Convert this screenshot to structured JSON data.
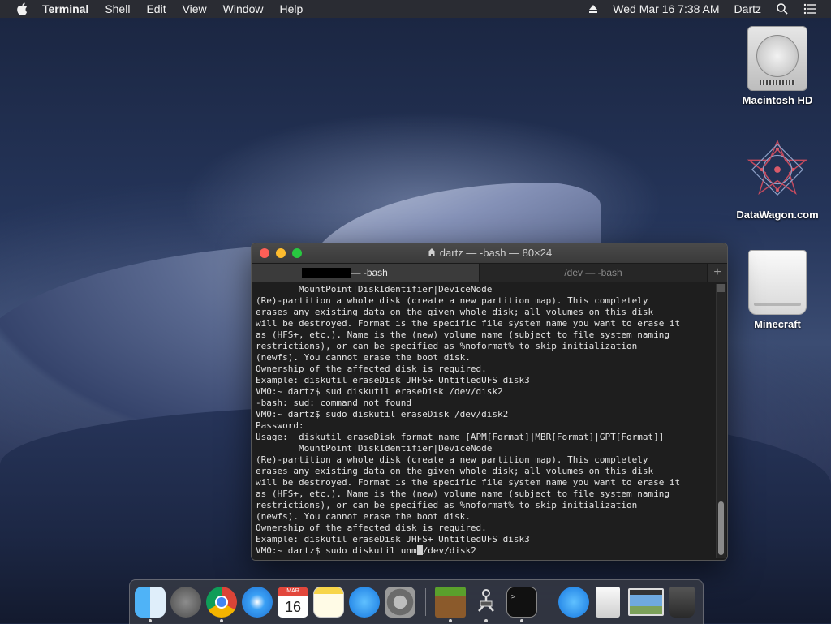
{
  "menubar": {
    "app_name": "Terminal",
    "menus": [
      "Shell",
      "Edit",
      "View",
      "Window",
      "Help"
    ],
    "datetime": "Wed Mar 16  7:38 AM",
    "user": "Dartz"
  },
  "desktop": {
    "icons": [
      "Macintosh HD",
      "DataWagon.com",
      "Minecraft"
    ]
  },
  "terminal": {
    "title": "dartz — -bash — 80×24",
    "tabs": [
      {
        "label": "~ — -bash"
      },
      {
        "label": "/dev — -bash"
      }
    ],
    "add_tab": "+",
    "lines": [
      "        MountPoint|DiskIdentifier|DeviceNode",
      "(Re)-partition a whole disk (create a new partition map). This completely",
      "erases any existing data on the given whole disk; all volumes on this disk",
      "will be destroyed. Format is the specific file system name you want to erase it",
      "as (HFS+, etc.). Name is the (new) volume name (subject to file system naming",
      "restrictions), or can be specified as %noformat% to skip initialization",
      "(newfs). You cannot erase the boot disk.",
      "Ownership of the affected disk is required.",
      "Example: diskutil eraseDisk JHFS+ UntitledUFS disk3",
      "VM0:~ dartz$ sud diskutil eraseDisk /dev/disk2",
      "-bash: sud: command not found",
      "VM0:~ dartz$ sudo diskutil eraseDisk /dev/disk2",
      "Password:",
      "Usage:  diskutil eraseDisk format name [APM[Format]|MBR[Format]|GPT[Format]]",
      "        MountPoint|DiskIdentifier|DeviceNode",
      "(Re)-partition a whole disk (create a new partition map). This completely",
      "erases any existing data on the given whole disk; all volumes on this disk",
      "will be destroyed. Format is the specific file system name you want to erase it",
      "as (HFS+, etc.). Name is the (new) volume name (subject to file system naming",
      "restrictions), or can be specified as %noformat% to skip initialization",
      "(newfs). You cannot erase the boot disk.",
      "Ownership of the affected disk is required.",
      "Example: diskutil eraseDisk JHFS+ UntitledUFS disk3"
    ],
    "prompt_before_cursor": "VM0:~ dartz$ sudo diskutil unm",
    "prompt_after_cursor": "/dev/disk2"
  },
  "dock": {
    "calendar_month": "MAR",
    "calendar_day": "16",
    "apps": [
      "finder-icon",
      "launchpad-icon",
      "chrome-icon",
      "safari-icon",
      "calendar-icon",
      "notes-icon",
      "app-store-icon",
      "system-preferences-icon",
      "minecraft-icon",
      "claw-icon",
      "terminal-icon",
      "downloads-icon",
      "document-icon",
      "screenshot-icon",
      "trash-icon"
    ]
  }
}
